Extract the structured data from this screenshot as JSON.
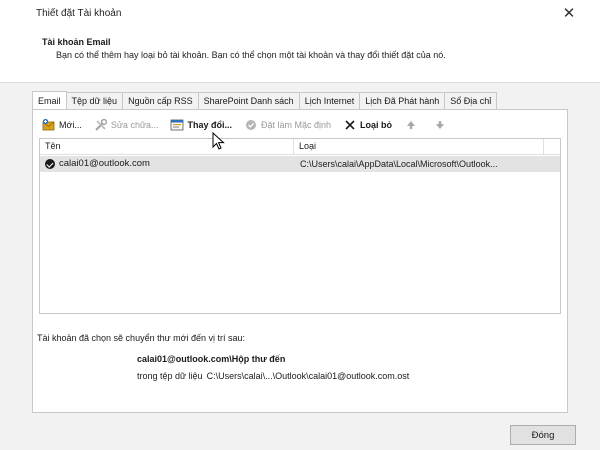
{
  "window": {
    "title": "Thiết đặt Tài khoản",
    "close_glyph": "✕"
  },
  "header": {
    "heading": "Tài khoản Email",
    "description": "Bạn có thể thêm hay loại bỏ tài khoản. Bạn có thể chọn một tài khoản và thay đổi thiết đặt của nó."
  },
  "tabs": [
    {
      "label": "Email",
      "active": true
    },
    {
      "label": "Tệp dữ liệu",
      "active": false
    },
    {
      "label": "Nguồn cấp RSS",
      "active": false
    },
    {
      "label": "SharePoint Danh sách",
      "active": false
    },
    {
      "label": "Lịch Internet",
      "active": false
    },
    {
      "label": "Lịch Đã Phát hành",
      "active": false
    },
    {
      "label": "Sổ Địa chỉ",
      "active": false
    }
  ],
  "toolbar": {
    "new_label": "Mới...",
    "repair_label": "Sửa chữa...",
    "change_label": "Thay đổi...",
    "default_label": "Đặt làm Mặc định",
    "remove_label": "Loại bỏ",
    "icons": {
      "new": "new-email-icon",
      "repair": "repair-tools-icon",
      "change": "change-settings-icon",
      "default": "checkmark-circle-icon",
      "remove": "x-icon",
      "up": "arrow-up-icon",
      "down": "arrow-down-icon"
    }
  },
  "list": {
    "columns": [
      "Tên",
      "Loại"
    ],
    "rows": [
      {
        "name": "calai01@outlook.com",
        "type": "C:\\Users\\calai\\AppData\\Local\\Microsoft\\Outlook...",
        "selected": true,
        "default": true
      }
    ]
  },
  "delivery": {
    "label": "Tài khoản đã chọn sẽ chuyển thư mới đến vị trí sau:",
    "folder": "calai01@outlook.com\\Hộp thư đến",
    "file_lead": "trong tệp dữ liệu",
    "file_path": "C:\\Users\\calai\\...\\Outlook\\calai01@outlook.com.ost"
  },
  "footer": {
    "close_label": "Đóng"
  },
  "colors": {
    "body_bg": "#f2f2f2",
    "selected_row": "#e3e3e3",
    "icon_blue": "#2f6fb5",
    "icon_gold": "#d9a21b"
  }
}
